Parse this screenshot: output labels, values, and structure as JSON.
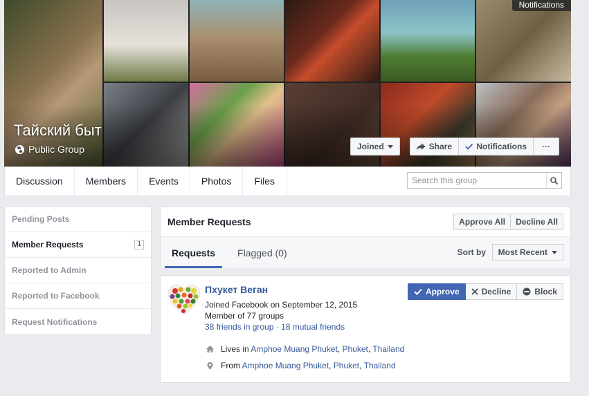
{
  "cover": {
    "group_name": "Тайский быт",
    "privacy": "Public Group",
    "tooltip": "Notifications",
    "joined_label": "Joined",
    "share_label": "Share",
    "notifications_label": "Notifications",
    "more_label": "···"
  },
  "nav": {
    "items": [
      "Discussion",
      "Members",
      "Events",
      "Photos",
      "Files"
    ],
    "search_placeholder": "Search this group"
  },
  "sidebar": {
    "items": [
      {
        "label": "Pending Posts"
      },
      {
        "label": "Member Requests",
        "count": "1"
      },
      {
        "label": "Reported to Admin"
      },
      {
        "label": "Reported to Facebook"
      },
      {
        "label": "Request Notifications"
      }
    ]
  },
  "panel": {
    "title": "Member Requests",
    "approve_all": "Approve All",
    "decline_all": "Decline All",
    "tabs": [
      "Requests",
      "Flagged (0)"
    ],
    "sort_label": "Sort by",
    "sort_value": "Most Recent"
  },
  "request": {
    "name": "Пхукет Веган",
    "joined": "Joined Facebook on September 12, 2015",
    "groups": "Member of 77 groups",
    "friends_in_group": "38 friends in group",
    "sep": " · ",
    "mutual": "18 mutual friends",
    "lives_prefix": "Lives in",
    "lives_place": "Amphoe Muang Phuket",
    "lives_city": "Phuket",
    "lives_country": "Thailand",
    "from_prefix": "From",
    "from_place": "Amphoe Muang Phuket",
    "from_city": "Phuket",
    "from_country": "Thailand",
    "comma": ",",
    "approve": "Approve",
    "decline": "Decline",
    "block": "Block"
  },
  "colors": {
    "accent": "#4267b2",
    "link": "#365899",
    "background": "#e9ebee"
  }
}
